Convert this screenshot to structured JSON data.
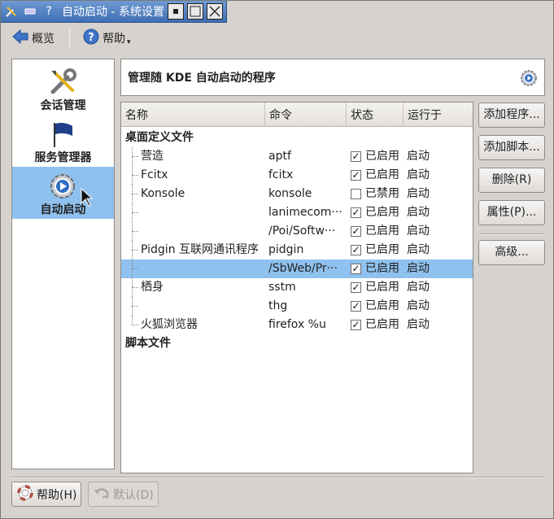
{
  "window": {
    "title": "自动启动 - 系统设置",
    "help_glyph": "?"
  },
  "toolbar": {
    "overview_label": "概览",
    "help_label": "帮助"
  },
  "sidebar": {
    "items": [
      {
        "label": "会话管理",
        "icon": "tools-icon"
      },
      {
        "label": "服务管理器",
        "icon": "flag-icon"
      },
      {
        "label": "自动启动",
        "icon": "gear-play-icon",
        "selected": true
      }
    ]
  },
  "header": {
    "title": "管理随 KDE 自动启动的程序"
  },
  "table": {
    "columns": [
      "名称",
      "命令",
      "状态",
      "运行于"
    ],
    "groups": [
      {
        "label": "桌面定义文件"
      },
      {
        "label": "脚本文件"
      }
    ],
    "rows": [
      {
        "name": "营造",
        "command": "aptf",
        "checked": true,
        "status": "已启用",
        "run_at": "启动",
        "selected": false
      },
      {
        "name": "Fcitx",
        "command": "fcitx",
        "checked": true,
        "status": "已启用",
        "run_at": "启动",
        "selected": false
      },
      {
        "name": "Konsole",
        "command": "konsole",
        "checked": false,
        "status": "已禁用",
        "run_at": "启动",
        "selected": false
      },
      {
        "name": "",
        "command": "lanimecom···",
        "checked": true,
        "status": "已启用",
        "run_at": "启动",
        "selected": false
      },
      {
        "name": "",
        "command": "/Poi/Softw···",
        "checked": true,
        "status": "已启用",
        "run_at": "启动",
        "selected": false
      },
      {
        "name": "Pidgin 互联网通讯程序",
        "command": "pidgin",
        "checked": true,
        "status": "已启用",
        "run_at": "启动",
        "selected": false
      },
      {
        "name": "",
        "command": "/SbWeb/Pr···",
        "checked": true,
        "status": "已启用",
        "run_at": "启动",
        "selected": true
      },
      {
        "name": "栖身",
        "command": "sstm",
        "checked": true,
        "status": "已启用",
        "run_at": "启动",
        "selected": false
      },
      {
        "name": "",
        "command": "thg",
        "checked": true,
        "status": "已启用",
        "run_at": "启动",
        "selected": false
      },
      {
        "name": "火狐浏览器",
        "command": "firefox %u",
        "checked": true,
        "status": "已启用",
        "run_at": "启动",
        "selected": false
      }
    ]
  },
  "actions": {
    "add_program": "添加程序...",
    "add_script": "添加脚本...",
    "remove": "删除(R)",
    "properties": "属性(P)...",
    "advanced": "高级..."
  },
  "footer": {
    "help": "帮助(H)",
    "defaults": "默认(D)"
  },
  "colors": {
    "selection": "#8fc1ee",
    "titlebar": "#4f7fc0"
  }
}
